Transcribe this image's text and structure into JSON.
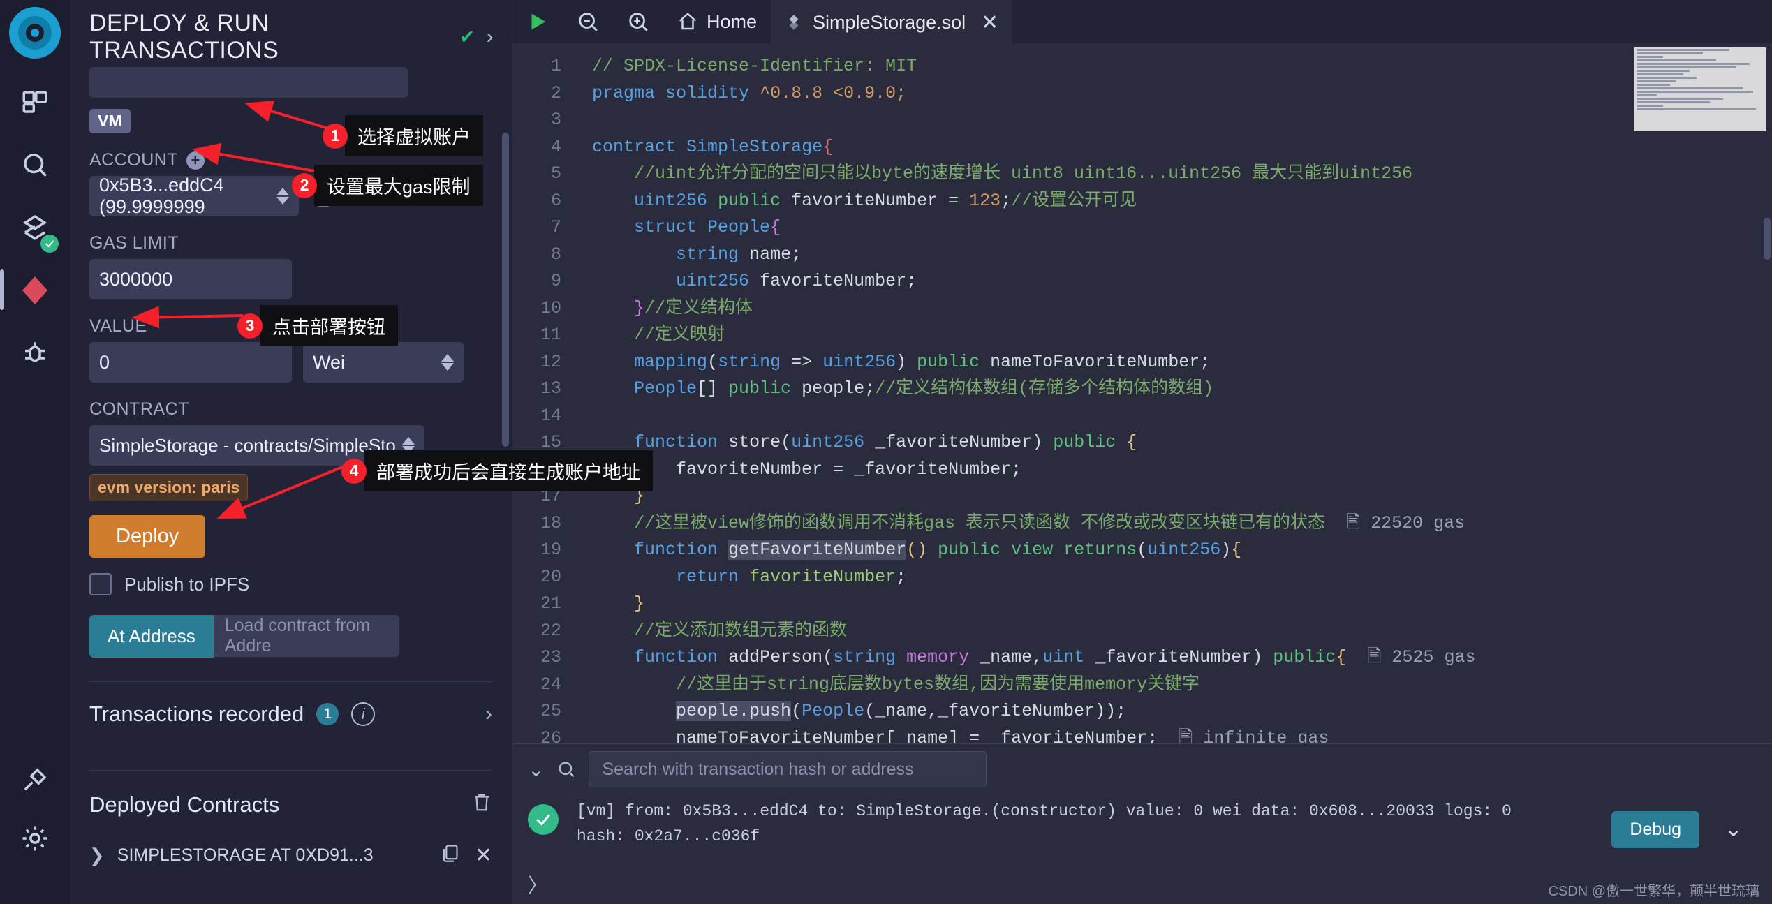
{
  "iconbar": {
    "items": [
      {
        "name": "logo",
        "label": "Remix"
      },
      {
        "name": "file-explorer",
        "label": "File explorer"
      },
      {
        "name": "search",
        "label": "Search in files"
      },
      {
        "name": "solidity-compiler",
        "label": "Solidity compiler"
      },
      {
        "name": "deploy-run",
        "label": "Deploy & run transactions"
      },
      {
        "name": "debugger",
        "label": "Debugger"
      },
      {
        "name": "plugin-manager",
        "label": "Plugin manager"
      },
      {
        "name": "settings",
        "label": "Settings"
      }
    ]
  },
  "panel": {
    "title": "DEPLOY & RUN TRANSACTIONS",
    "environment_badge": "VM",
    "account_label": "ACCOUNT",
    "account_value": "0x5B3...eddC4 (99.9999999",
    "gas_limit_label": "GAS LIMIT",
    "gas_limit_value": "3000000",
    "value_label": "VALUE",
    "value_value": "0",
    "value_unit": "Wei",
    "contract_label": "CONTRACT",
    "contract_value": "SimpleStorage - contracts/SimpleSto",
    "evm_version": "evm version: paris",
    "deploy_label": "Deploy",
    "publish_ipfs_label": "Publish to IPFS",
    "at_address_label": "At Address",
    "at_address_placeholder": "Load contract from Addre",
    "transactions_recorded_label": "Transactions recorded",
    "transactions_recorded_count": "1",
    "deployed_contracts_label": "Deployed Contracts",
    "deployed_contract_item": "SIMPLESTORAGE AT 0XD91...3"
  },
  "topbar": {
    "run_label": "run",
    "zoom_out_label": "zoom out",
    "zoom_in_label": "zoom in",
    "home_label": "Home",
    "tab_label": "SimpleStorage.sol"
  },
  "editor": {
    "lines": [
      {
        "n": "1",
        "html": "<span class='cmt'>// SPDX-License-Identifier: MIT</span>"
      },
      {
        "n": "2",
        "html": "<span class='kw'>pragma solidity</span> <span class='pn'>^0.8.8 &lt;0.9.0;</span>"
      },
      {
        "n": "3",
        "html": ""
      },
      {
        "n": "4",
        "html": "<span class='kw'>contract</span> <span class='typ'>SimpleStorage</span><span class='br'>{</span>"
      },
      {
        "n": "5",
        "html": "    <span class='cmt'>//uint允许分配的空间只能以byte的速度增长 uint8 uint16...uint256 最大只能到uint256</span>"
      },
      {
        "n": "6",
        "html": "    <span class='typ'>uint256</span> <span class='vis'>public</span> <span class='var'>favoriteNumber</span> = <span class='pn'>123</span>;<span class='cmt'>//设置公开可见</span>"
      },
      {
        "n": "7",
        "html": "    <span class='kw'>struct</span> <span class='typ'>People</span><span class='brp'>{</span>"
      },
      {
        "n": "8",
        "html": "        <span class='typ'>string</span> <span class='var'>name</span>;"
      },
      {
        "n": "9",
        "html": "        <span class='typ'>uint256</span> <span class='var'>favoriteNumber</span>;"
      },
      {
        "n": "10",
        "html": "    <span class='brp'>}</span><span class='cmt'>//定义结构体</span>"
      },
      {
        "n": "11",
        "html": "    <span class='cmt'>//定义映射</span>"
      },
      {
        "n": "12",
        "html": "    <span class='kw'>mapping</span>(<span class='typ'>string</span> =&gt; <span class='typ'>uint256</span>) <span class='vis'>public</span> <span class='var'>nameToFavoriteNumber</span>;"
      },
      {
        "n": "13",
        "html": "    <span class='typ'>People</span>[] <span class='vis'>public</span> <span class='var'>people</span>;<span class='cmt'>//定义结构体数组(存储多个结构体的数组)</span>"
      },
      {
        "n": "14",
        "html": ""
      },
      {
        "n": "15",
        "html": "    <span class='kw'>function</span> <span class='fn'>store</span>(<span class='typ'>uint256</span> <span class='var'>_favoriteNumber</span>) <span class='vis'>public</span> <span class='bry'>{</span>"
      },
      {
        "n": "16",
        "html": "        <span class='var'>favoriteNumber</span> = <span class='var'>_favoriteNumber</span>;"
      },
      {
        "n": "17",
        "html": "    <span class='bry'>}</span>"
      },
      {
        "n": "18",
        "html": "    <span class='cmt'>//这里被view修饰的函数调用不消耗gas 表示只读函数 不修改或改变区块链已有的状态</span>"
      },
      {
        "n": "19",
        "html": "    <span class='kw'>function</span> <span class='fn hl'>getFavoriteNumber</span><span class='bry'>()</span> <span class='vis'>public</span> <span class='vis'>view</span> <span class='vis'>returns</span>(<span class='typ'>uint256</span>)<span class='bry'>{</span>"
      },
      {
        "n": "20",
        "html": "        <span class='kw'>return</span> <span class='str'>favoriteNumber</span>;"
      },
      {
        "n": "21",
        "html": "    <span class='bry'>}</span>"
      },
      {
        "n": "22",
        "html": "    <span class='cmt'>//定义添加数组元素的函数</span>"
      },
      {
        "n": "23",
        "html": "    <span class='kw'>function</span> <span class='fn'>addPerson</span>(<span class='typ'>string</span> <span class='kw2'>memory</span> <span class='var'>_name</span>,<span class='typ'>uint</span> <span class='var'>_favoriteNumber</span>) <span class='vis'>public</span><span class='bry'>{</span>"
      },
      {
        "n": "24",
        "html": "        <span class='cmt'>//这里由于string底层数bytes数组,因为需要使用memory关键字</span>"
      },
      {
        "n": "25",
        "html": "        <span class='var hl'>people.push</span>(<span class='typ'>People</span>(<span class='var'>_name</span>,<span class='var'>_favoriteNumber</span>));"
      },
      {
        "n": "26",
        "html": "        <span class='var'>nameToFavoriteNumber</span>[<span class='var'>_name</span>] = <span class='var'>_favoriteNumber</span>;"
      }
    ],
    "gas_annotations": [
      {
        "line": "18",
        "text": "22520 gas"
      },
      {
        "line": "23",
        "text": "2525 gas"
      },
      {
        "line": "26",
        "text": "infinite gas"
      }
    ]
  },
  "terminal": {
    "search_placeholder": "Search with transaction hash or address",
    "tx_line1": "[vm] from: 0x5B3...eddC4 to: SimpleStorage.(constructor) value: 0 wei data: 0x608...20033 logs: 0",
    "tx_line2": "hash: 0x2a7...c036f",
    "debug_label": "Debug",
    "prompt": "〉",
    "watermark": "CSDN @傲一世繁华，颠半世琉璃"
  },
  "annotations": [
    {
      "n": "1",
      "text": "选择虚拟账户"
    },
    {
      "n": "2",
      "text": "设置最大gas限制"
    },
    {
      "n": "3",
      "text": "点击部署按钮"
    },
    {
      "n": "4",
      "text": "部署成功后会直接生成账户地址"
    }
  ],
  "colors": {
    "accent_blue": "#2b7d96",
    "deploy_orange": "#cf7c2e",
    "success_green": "#32ba89",
    "annotation_red": "#f4202a"
  }
}
